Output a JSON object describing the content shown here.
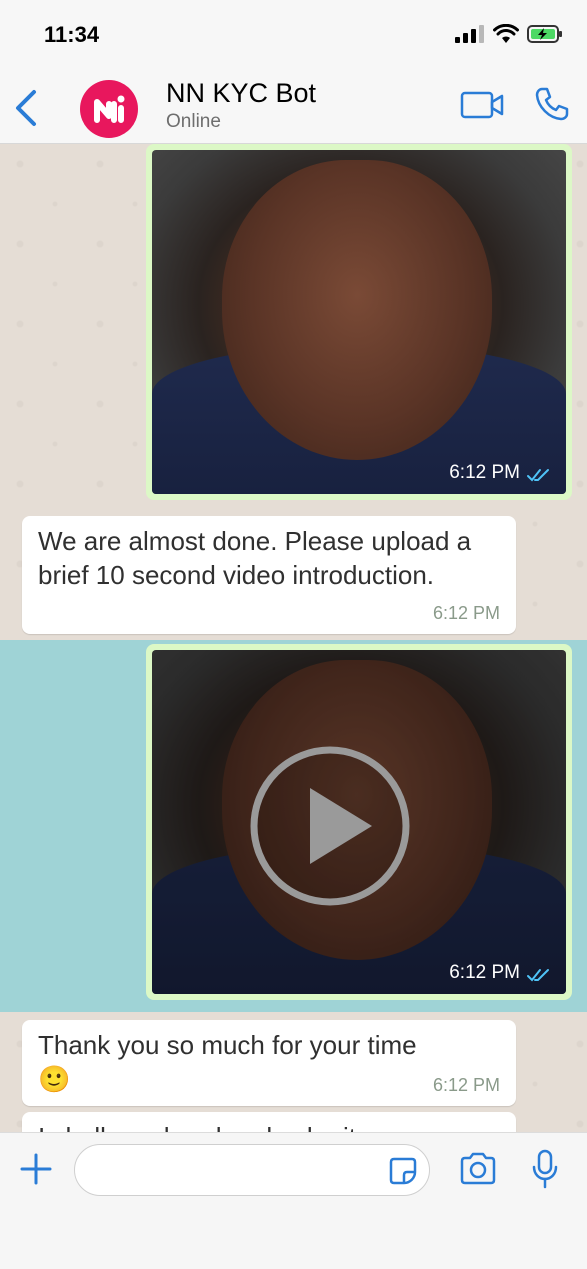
{
  "status_bar": {
    "time": "11:34",
    "icons": [
      "signal-icon",
      "wifi-icon",
      "battery-charging-icon"
    ]
  },
  "header": {
    "contact_name": "NN KYC Bot",
    "contact_status": "Online",
    "avatar_color": "#e8175d",
    "accent_color": "#2a7cd6",
    "icons": [
      "back-chevron-icon",
      "video-call-icon",
      "phone-icon"
    ]
  },
  "messages": [
    {
      "type": "image",
      "direction": "outgoing",
      "time": "6:12 PM",
      "status": "read"
    },
    {
      "type": "text",
      "direction": "incoming",
      "text": "We are almost done. Please upload a brief 10 second video introduction.",
      "time": "6:12 PM"
    },
    {
      "type": "video",
      "direction": "outgoing",
      "time": "6:12 PM",
      "status": "read"
    },
    {
      "type": "text",
      "direction": "incoming",
      "text": "Thank you so much for your time 🙂",
      "time": "6:12 PM"
    },
    {
      "type": "text",
      "direction": "incoming",
      "text": "I shall go ahead and submit your",
      "time": ""
    }
  ],
  "colors": {
    "chat_background": "#e5ddd5",
    "highlight_band": "#9fd3d6",
    "outgoing_bubble": "#dcf8c6",
    "incoming_bubble": "#ffffff",
    "read_ticks": "#4fc3f7"
  },
  "input_bar": {
    "placeholder": "",
    "icons": [
      "plus-icon",
      "sticker-icon",
      "camera-icon",
      "microphone-icon"
    ]
  }
}
